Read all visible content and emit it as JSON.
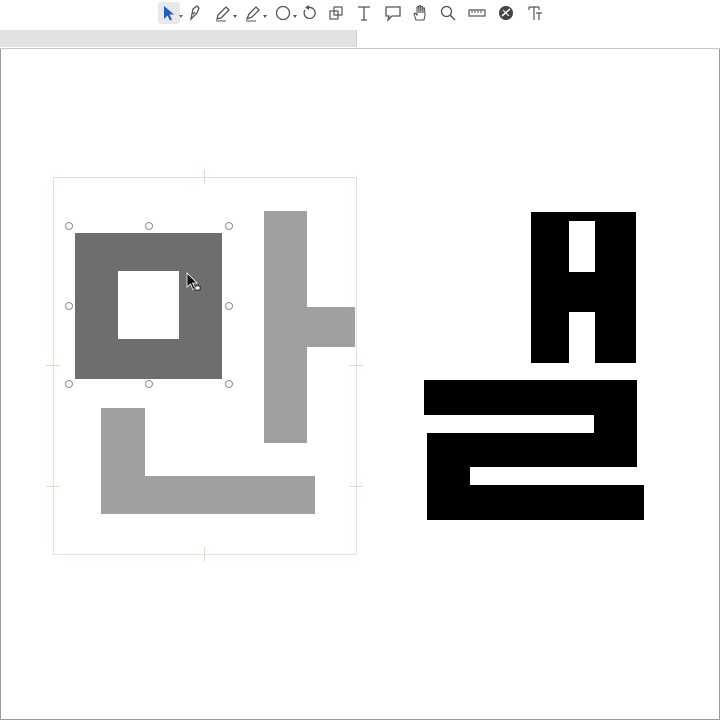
{
  "toolbar": {
    "tools": [
      {
        "name": "select-tool",
        "icon": "arrow-pointer-icon",
        "active": true
      },
      {
        "name": "pen-tool",
        "icon": "pen-nib-icon"
      },
      {
        "name": "pencil-tool",
        "icon": "pencil-icon"
      },
      {
        "name": "brush-tool",
        "icon": "brush-icon"
      },
      {
        "name": "shape-tool",
        "icon": "ellipse-icon"
      },
      {
        "name": "rotate-tool",
        "icon": "rotate-icon"
      },
      {
        "name": "scale-tool",
        "icon": "scale-icon"
      },
      {
        "name": "text-tool",
        "icon": "text-icon"
      },
      {
        "name": "comment-tool",
        "icon": "speech-bubble-icon"
      },
      {
        "name": "hand-tool",
        "icon": "hand-icon"
      },
      {
        "name": "zoom-tool",
        "icon": "magnifier-icon"
      },
      {
        "name": "measure-tool",
        "icon": "ruler-icon"
      },
      {
        "name": "slice-tool",
        "icon": "slice-icon"
      },
      {
        "name": "type-tool",
        "icon": "type-icon"
      }
    ]
  },
  "colors": {
    "selected_shape": "#6e6e6e",
    "glyph_gray": "#a0a0a0",
    "glyph_black": "#000000",
    "frame_guide": "#f1ddd0",
    "active_tool": "#2a6fd6"
  }
}
